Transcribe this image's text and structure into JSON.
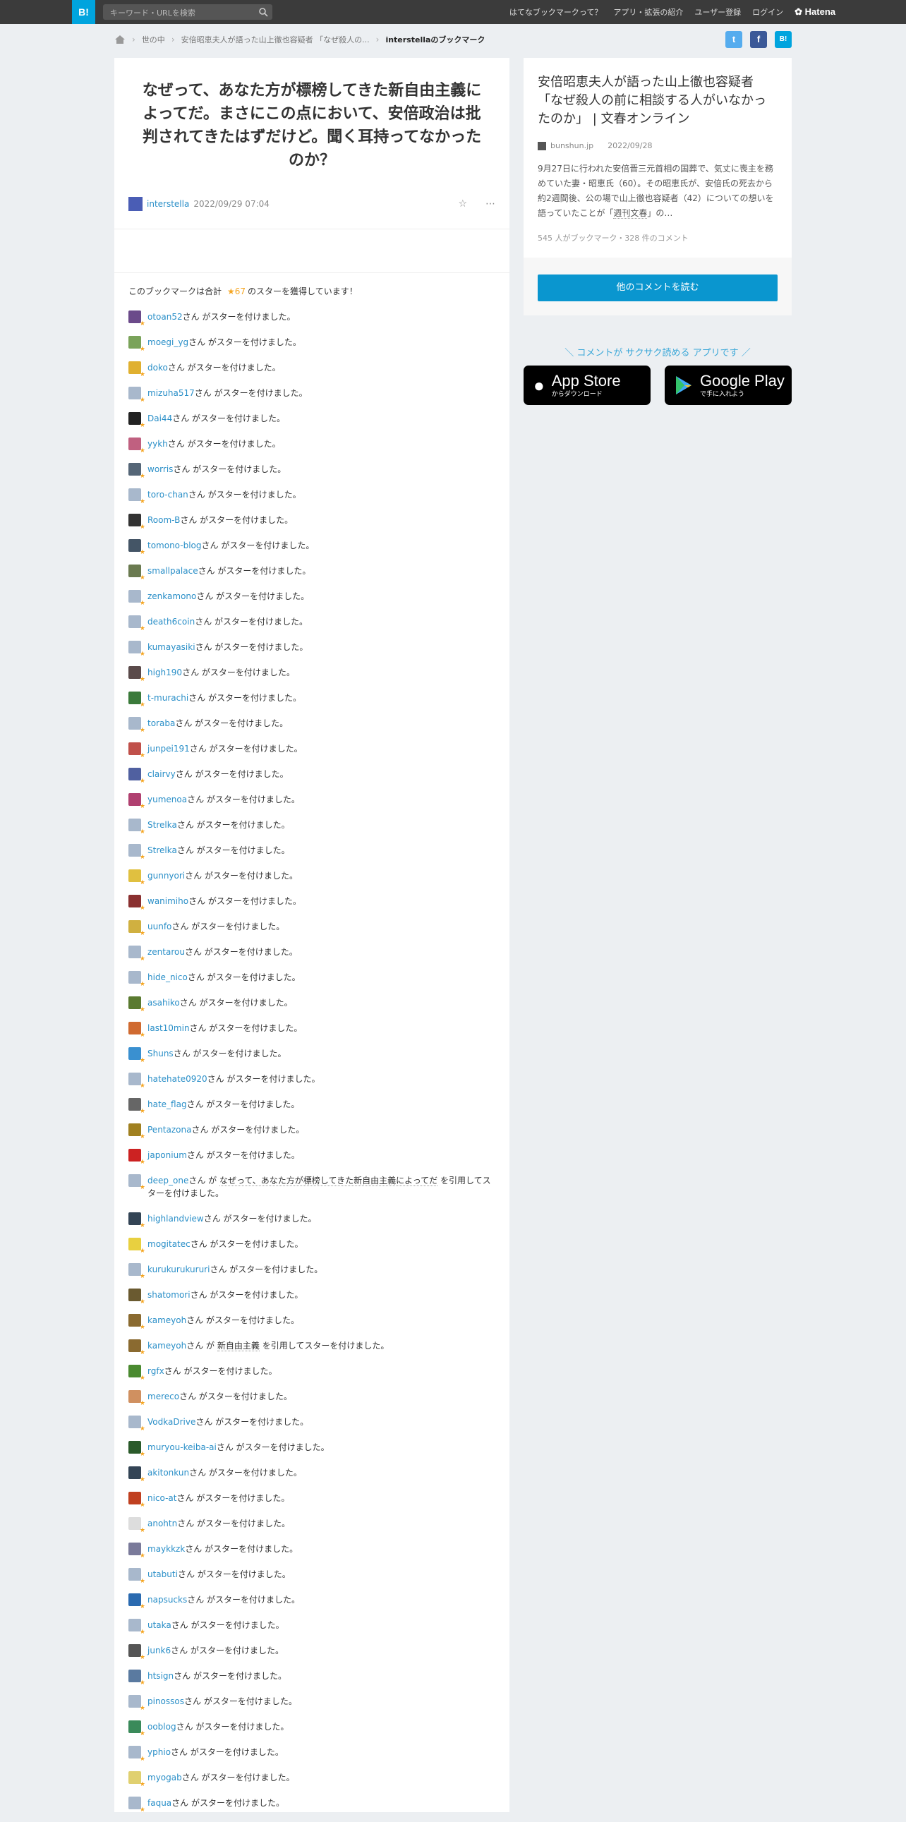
{
  "header": {
    "logo": "B!",
    "search_placeholder": "キーワード・URLを検索",
    "nav": [
      "はてなブックマークって？",
      "アプリ・拡張の紹介",
      "ユーザー登録",
      "ログイン"
    ],
    "brand": "Hatena"
  },
  "breadcrumb": {
    "items": [
      "世の中",
      "安倍昭恵夫人が語った山上徹也容疑者 「なぜ殺人の..."
    ],
    "current": "interstellaのブックマーク"
  },
  "share": {
    "twitter": "t",
    "facebook": "f",
    "hatena": "B!"
  },
  "bookmark": {
    "comment": "なぜって、あなた方が標榜してきた新自由主義によってだ。まさにこの点において、安倍政治は批判されてきたはずだけど。聞く耳持ってなかったのか？",
    "user": "interstella",
    "date": "2022/09/29 07:04",
    "star_icon": "☆",
    "more_icon": "⋯",
    "summary_pre": "このブックマークは合計",
    "star_count": "★67",
    "summary_post": "のスターを獲得しています！"
  },
  "stars": [
    {
      "user": "otoan52",
      "text": "さん がスターを付けました。",
      "color": "#6b4a8a"
    },
    {
      "user": "moegi_yg",
      "text": "さん がスターを付けました。",
      "color": "#7aa35a"
    },
    {
      "user": "doko",
      "text": "さん がスターを付けました。",
      "color": "#e0b030"
    },
    {
      "user": "mizuha517",
      "text": "さん がスターを付けました。",
      "color": "#a8b8cc"
    },
    {
      "user": "Dai44",
      "text": "さん がスターを付けました。",
      "color": "#222222"
    },
    {
      "user": "yykh",
      "text": "さん がスターを付けました。",
      "color": "#c06080"
    },
    {
      "user": "worris",
      "text": "さん がスターを付けました。",
      "color": "#556677"
    },
    {
      "user": "toro-chan",
      "text": "さん がスターを付けました。",
      "color": "#a8b8cc"
    },
    {
      "user": "Room-B",
      "text": "さん がスターを付けました。",
      "color": "#333333"
    },
    {
      "user": "tomono-blog",
      "text": "さん がスターを付けました。",
      "color": "#445566"
    },
    {
      "user": "smallpalace",
      "text": "さん がスターを付けました。",
      "color": "#6a7a50"
    },
    {
      "user": "zenkamono",
      "text": "さん がスターを付けました。",
      "color": "#a8b8cc"
    },
    {
      "user": "death6coin",
      "text": "さん がスターを付けました。",
      "color": "#a8b8cc"
    },
    {
      "user": "kumayasiki",
      "text": "さん がスターを付けました。",
      "color": "#a8b8cc"
    },
    {
      "user": "high190",
      "text": "さん がスターを付けました。",
      "color": "#5a4a4a"
    },
    {
      "user": "t-murachi",
      "text": "さん がスターを付けました。",
      "color": "#3a7a3a"
    },
    {
      "user": "toraba",
      "text": "さん がスターを付けました。",
      "color": "#a8b8cc"
    },
    {
      "user": "junpei191",
      "text": "さん がスターを付けました。",
      "color": "#c0504a"
    },
    {
      "user": "clairvy",
      "text": "さん がスターを付けました。",
      "color": "#5060a0"
    },
    {
      "user": "yumenoa",
      "text": "さん がスターを付けました。",
      "color": "#b04070"
    },
    {
      "user": "Strelka",
      "text": "さん がスターを付けました。",
      "color": "#a8b8cc"
    },
    {
      "user": "Strelka",
      "text": "さん がスターを付けました。",
      "color": "#a8b8cc"
    },
    {
      "user": "gunnyori",
      "text": "さん がスターを付けました。",
      "color": "#e0c040"
    },
    {
      "user": "wanimiho",
      "text": "さん がスターを付けました。",
      "color": "#8a3030"
    },
    {
      "user": "uunfo",
      "text": "さん がスターを付けました。",
      "color": "#d0b040"
    },
    {
      "user": "zentarou",
      "text": "さん がスターを付けました。",
      "color": "#a8b8cc"
    },
    {
      "user": "hide_nico",
      "text": "さん がスターを付けました。",
      "color": "#a8b8cc"
    },
    {
      "user": "asahiko",
      "text": "さん がスターを付けました。",
      "color": "#5a7a30"
    },
    {
      "user": "last10min",
      "text": "さん がスターを付けました。",
      "color": "#d06a30"
    },
    {
      "user": "Shuns",
      "text": "さん がスターを付けました。",
      "color": "#3a90d0"
    },
    {
      "user": "hatehate0920",
      "text": "さん がスターを付けました。",
      "color": "#a8b8cc"
    },
    {
      "user": "hate_flag",
      "text": "さん がスターを付けました。",
      "color": "#666666"
    },
    {
      "user": "Pentazona",
      "text": "さん がスターを付けました。",
      "color": "#a08020"
    },
    {
      "user": "japonium",
      "text": "さん がスターを付けました。",
      "color": "#cc2222"
    },
    {
      "user": "deep_one",
      "text": "さん が",
      "quote": "なぜって、あなた方が標榜してきた新自由主義によってだ",
      "text_after": " を引用してスターを付けました。",
      "color": "#a8b8cc"
    },
    {
      "user": "highlandview",
      "text": "さん がスターを付けました。",
      "color": "#334455"
    },
    {
      "user": "mogitatec",
      "text": "さん がスターを付けました。",
      "color": "#e8d040"
    },
    {
      "user": "kurukurukururi",
      "text": "さん がスターを付けました。",
      "color": "#a8b8cc"
    },
    {
      "user": "shatomori",
      "text": "さん がスターを付けました。",
      "color": "#6a5a30"
    },
    {
      "user": "kameyoh",
      "text": "さん がスターを付けました。",
      "color": "#8a6a30"
    },
    {
      "user": "kameyoh",
      "text": "さん が",
      "quote": "新自由主義",
      "text_after": " を引用してスターを付けました。",
      "color": "#8a6a30"
    },
    {
      "user": "rgfx",
      "text": "さん がスターを付けました。",
      "color": "#4a8a30"
    },
    {
      "user": "mereco",
      "text": "さん がスターを付けました。",
      "color": "#d09060"
    },
    {
      "user": "VodkaDrive",
      "text": "さん がスターを付けました。",
      "color": "#a8b8cc"
    },
    {
      "user": "muryou-keiba-ai",
      "text": "さん がスターを付けました。",
      "color": "#2a5a2a"
    },
    {
      "user": "akitonkun",
      "text": "さん がスターを付けました。",
      "color": "#334455"
    },
    {
      "user": "nico-at",
      "text": "さん がスターを付けました。",
      "color": "#c04020"
    },
    {
      "user": "anohtn",
      "text": "さん がスターを付けました。",
      "color": "#dddddd"
    },
    {
      "user": "maykkzk",
      "text": "さん がスターを付けました。",
      "color": "#7a7a9a"
    },
    {
      "user": "utabuti",
      "text": "さん がスターを付けました。",
      "color": "#a8b8cc"
    },
    {
      "user": "napsucks",
      "text": "さん がスターを付けました。",
      "color": "#2a6ab0"
    },
    {
      "user": "utaka",
      "text": "さん がスターを付けました。",
      "color": "#a8b8cc"
    },
    {
      "user": "junk6",
      "text": "さん がスターを付けました。",
      "color": "#555555"
    },
    {
      "user": "htsign",
      "text": "さん がスターを付けました。",
      "color": "#5a7aa0"
    },
    {
      "user": "pinossos",
      "text": "さん がスターを付けました。",
      "color": "#a8b8cc"
    },
    {
      "user": "ooblog",
      "text": "さん がスターを付けました。",
      "color": "#3a8a5a"
    },
    {
      "user": "yphio",
      "text": "さん がスターを付けました。",
      "color": "#a8b8cc"
    },
    {
      "user": "myogab",
      "text": "さん がスターを付けました。",
      "color": "#e0d070"
    },
    {
      "user": "faqua",
      "text": "さん がスターを付けました。",
      "color": "#a8b8cc"
    }
  ],
  "entry": {
    "title": "安倍昭恵夫人が語った山上徹也容疑者「なぜ殺人の前に相談する人がいなかったのか」 | 文春オンライン",
    "domain": "bunshun.jp",
    "date": "2022/09/28",
    "desc_pre": "9月27日に行われた安倍晋三元首相の国葬で、気丈に喪主を務めていた妻・昭恵氏（60）。その昭恵氏が、安倍氏の死去から約2週間後、公の場で山上徹也容疑者（42）についての想いを語っていたことが「",
    "desc_link": "週刊文春",
    "desc_post": "」の…",
    "counts": "545 人がブックマーク・328 件のコメント",
    "more_button": "他のコメントを読む"
  },
  "promo": {
    "text": "＼ コメントが サクサク読める アプリです ／",
    "appstore_small": "からダウンロード",
    "appstore_big": "App Store",
    "googleplay_big": "Google Play",
    "googleplay_small": "で手に入れよう"
  }
}
